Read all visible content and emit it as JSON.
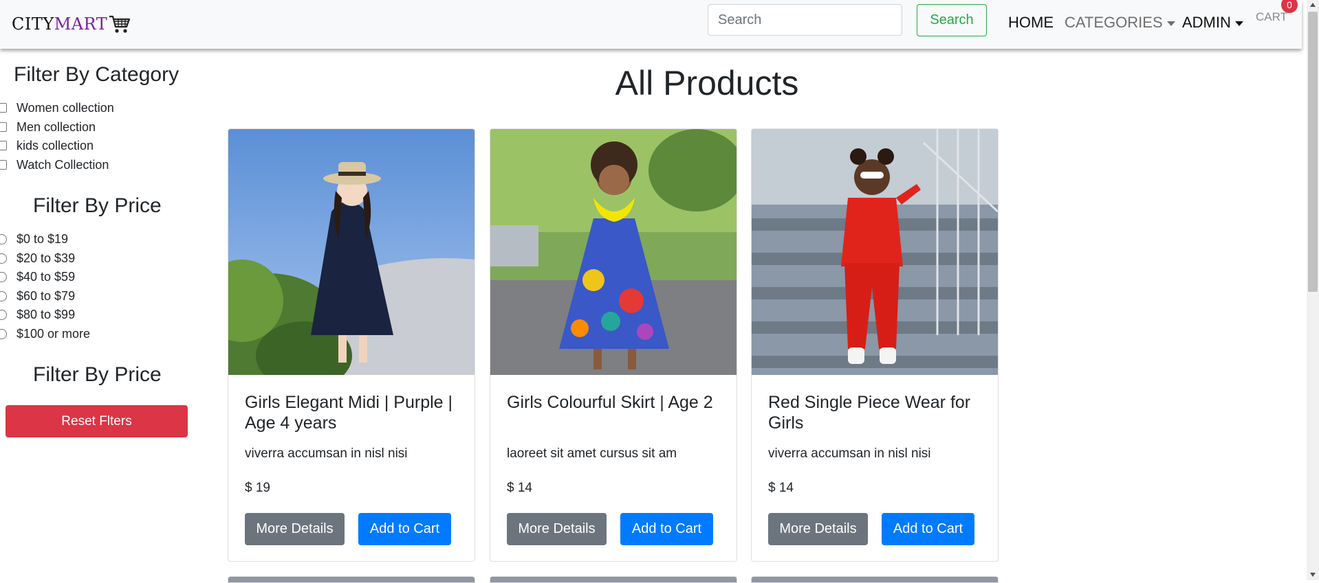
{
  "navbar": {
    "brand_city": "CITY",
    "brand_mart": "MART",
    "brand_icon": "shopping-cart-icon",
    "search_placeholder": "Search",
    "search_button": "Search",
    "home": "HOME",
    "categories": "CATEGORIES",
    "admin": "ADMIN",
    "cart": "CART",
    "cart_count": "0"
  },
  "sidebar": {
    "category_heading": "Filter By Category",
    "categories": [
      "Women collection",
      "Men collection",
      "kids collection",
      "Watch Collection"
    ],
    "price_heading": "Filter By Price",
    "prices": [
      "$0 to $19",
      "$20 to $39",
      "$40 to $59",
      "$60 to $79",
      "$80 to $99",
      "$100 or more"
    ],
    "second_price_heading": "Filter By Price",
    "reset_button": "Reset Flters"
  },
  "main": {
    "title": "All Products",
    "products": [
      {
        "title": "Girls Elegant Midi | Purple | Age 4 years",
        "description": "viverra accumsan in nisl nisi",
        "price": "$ 19",
        "details_button": "More Details",
        "cart_button": "Add to Cart"
      },
      {
        "title": "Girls Colourful Skirt | Age 2",
        "description": "laoreet sit amet cursus sit am",
        "price": "$ 14",
        "details_button": "More Details",
        "cart_button": "Add to Cart"
      },
      {
        "title": "Red Single Piece Wear for Girls",
        "description": "viverra accumsan in nisl nisi",
        "price": "$ 14",
        "details_button": "More Details",
        "cart_button": "Add to Cart"
      }
    ]
  },
  "colors": {
    "brand_mart": "#7b1fa2",
    "search_green": "#28a745",
    "danger": "#dc3545",
    "primary": "#007bff",
    "secondary": "#6c757d"
  }
}
